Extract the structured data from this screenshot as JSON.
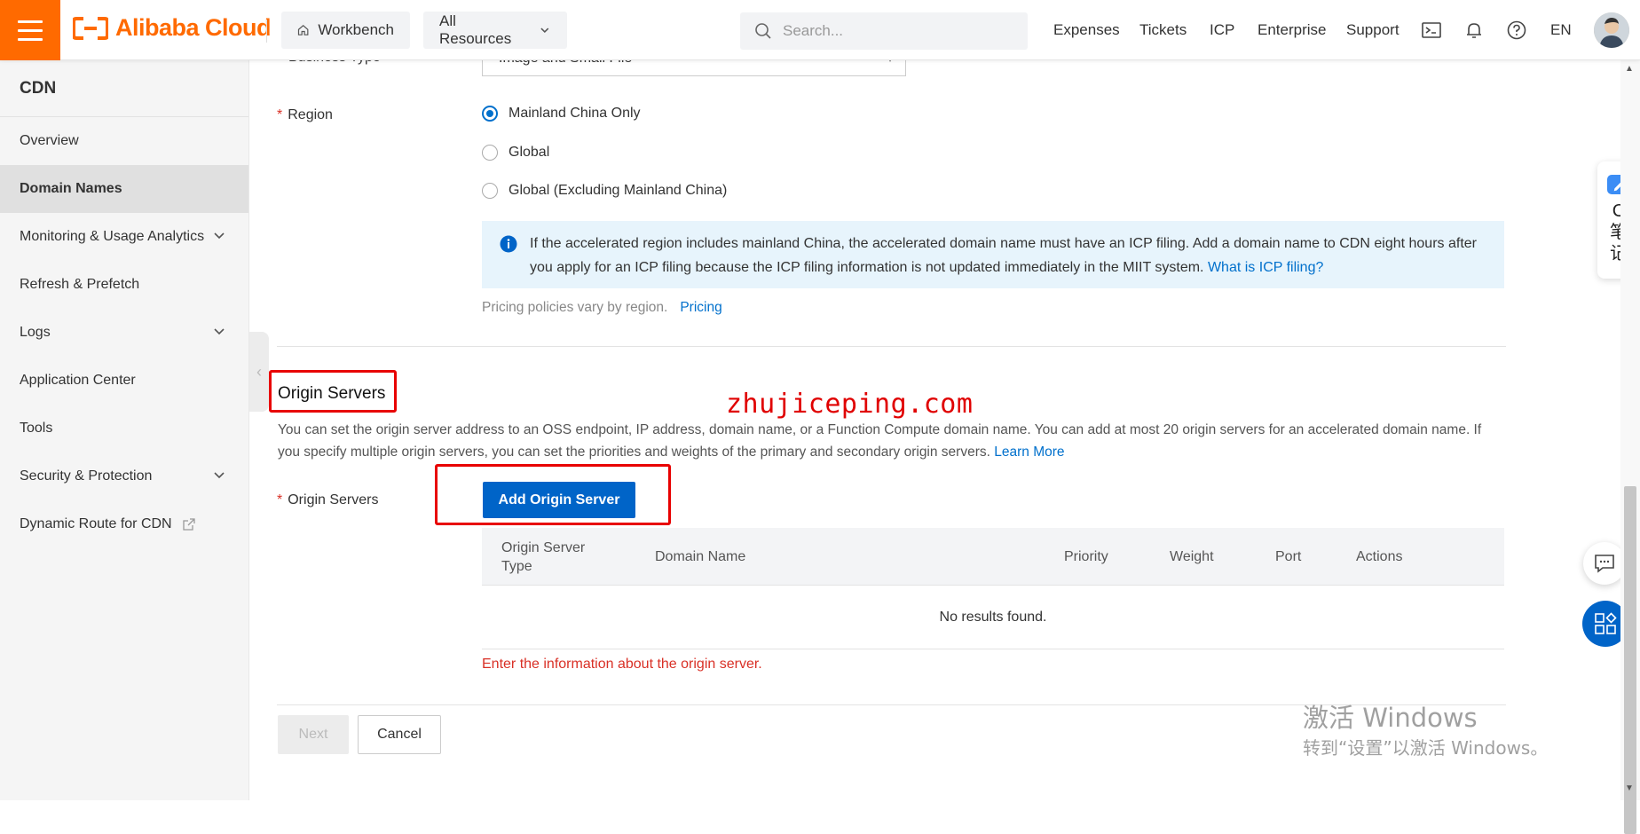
{
  "header": {
    "logo_text": "Alibaba Cloud",
    "workbench": "Workbench",
    "all_resources": "All Resources",
    "search_placeholder": "Search...",
    "nav": [
      "Expenses",
      "Tickets",
      "ICP",
      "Enterprise",
      "Support"
    ],
    "lang": "EN",
    "brand_color": "#ff6a00"
  },
  "sidebar": {
    "title": "CDN",
    "items": [
      {
        "label": "Overview",
        "icon": null
      },
      {
        "label": "Domain Names",
        "icon": null
      },
      {
        "label": "Monitoring & Usage Analytics",
        "icon": "chevron-down-icon"
      },
      {
        "label": "Refresh & Prefetch",
        "icon": null
      },
      {
        "label": "Logs",
        "icon": "chevron-down-icon"
      },
      {
        "label": "Application Center",
        "icon": null
      },
      {
        "label": "Tools",
        "icon": null
      },
      {
        "label": "Security & Protection",
        "icon": "chevron-down-icon"
      },
      {
        "label": "Dynamic Route for CDN",
        "icon": "external-link-icon"
      }
    ],
    "active": "Domain Names"
  },
  "form": {
    "business_type_label": "Business Type",
    "business_type_value": "Image and Small File",
    "region_label": "Region",
    "region_options": [
      "Mainland China Only",
      "Global",
      "Global (Excluding Mainland China)"
    ],
    "region_selected": "Mainland China Only",
    "notice_text": "If the accelerated region includes mainland China, the accelerated domain name must have an ICP filing. Add a domain name to CDN eight hours after you apply for an ICP filing because the ICP filing information is not updated immediately in the MIIT system.",
    "notice_link": "What is ICP filing?",
    "pricing_text": "Pricing policies vary by region.",
    "pricing_link": "Pricing"
  },
  "origin": {
    "section_title": "Origin Servers",
    "description": "You can set the origin server address to an OSS endpoint, IP address, domain name, or a Function Compute domain name. You can add at most 20 origin servers for an accelerated domain name. If you specify multiple origin servers, you can set the priorities and weights of the primary and secondary origin servers.",
    "learn_more": "Learn More",
    "field_label": "Origin Servers",
    "add_button": "Add Origin Server",
    "columns": [
      "Origin Server Type",
      "Domain Name",
      "Priority",
      "Weight",
      "Port",
      "Actions"
    ],
    "empty_text": "No results found.",
    "error_text": "Enter the information about the origin server."
  },
  "actions": {
    "next": "Next",
    "cancel": "Cancel"
  },
  "overlay": {
    "site_watermark": "zhujiceping.com",
    "windows_line1": "激活 Windows",
    "windows_line2": "转到“设置”以激活 Windows。",
    "float_note": [
      "C",
      "笔",
      "记"
    ]
  }
}
